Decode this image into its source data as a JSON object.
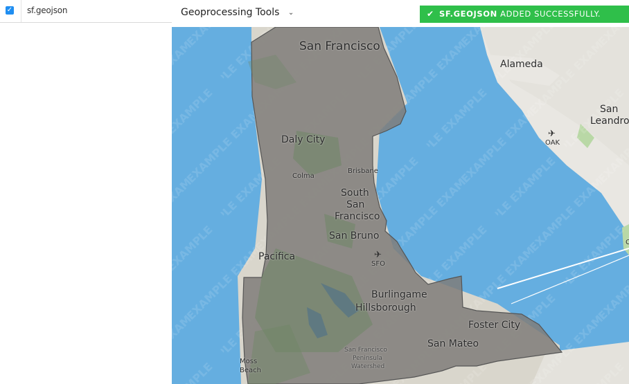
{
  "sidebar": {
    "layer": {
      "checked": true,
      "name": "sf.geojson"
    }
  },
  "toolbar": {
    "geoprocessing_label": "Geoprocessing Tools",
    "chevron_icon": "chevron-down-icon"
  },
  "toast": {
    "icon": "check-icon",
    "filename": "SF.GEOJSON",
    "message": "ADDED SUCCESSFULLY.",
    "color": "#2fbf4a"
  },
  "map": {
    "watermark": "EXAMPLE",
    "places": {
      "san_francisco": "San Francisco",
      "alameda": "Alameda",
      "san_leandro_1": "San",
      "san_leandro_2": "Leandro",
      "oak": "OAK",
      "daly_city": "Daly City",
      "brisbane": "Brisbane",
      "colma": "Colma",
      "south_sf_1": "South",
      "south_sf_2": "San",
      "south_sf_3": "Francisco",
      "san_bruno": "San Bruno",
      "pacifica": "Pacifica",
      "sfo": "SFO",
      "burlingame": "Burlingame",
      "hillsborough": "Hillsborough",
      "foster_city": "Foster City",
      "san_mateo": "San Mateo",
      "watershed_1": "San Francisco",
      "watershed_2": "Peninsula",
      "watershed_3": "Watershed",
      "moss_beach_1": "Moss",
      "moss_beach_2": "Beach",
      "edge_c": "C"
    },
    "colors": {
      "water": "#65aee0",
      "land": "#e9e7e2",
      "polygon_fill": "#8c8a86",
      "polygon_stroke": "#555555"
    }
  }
}
